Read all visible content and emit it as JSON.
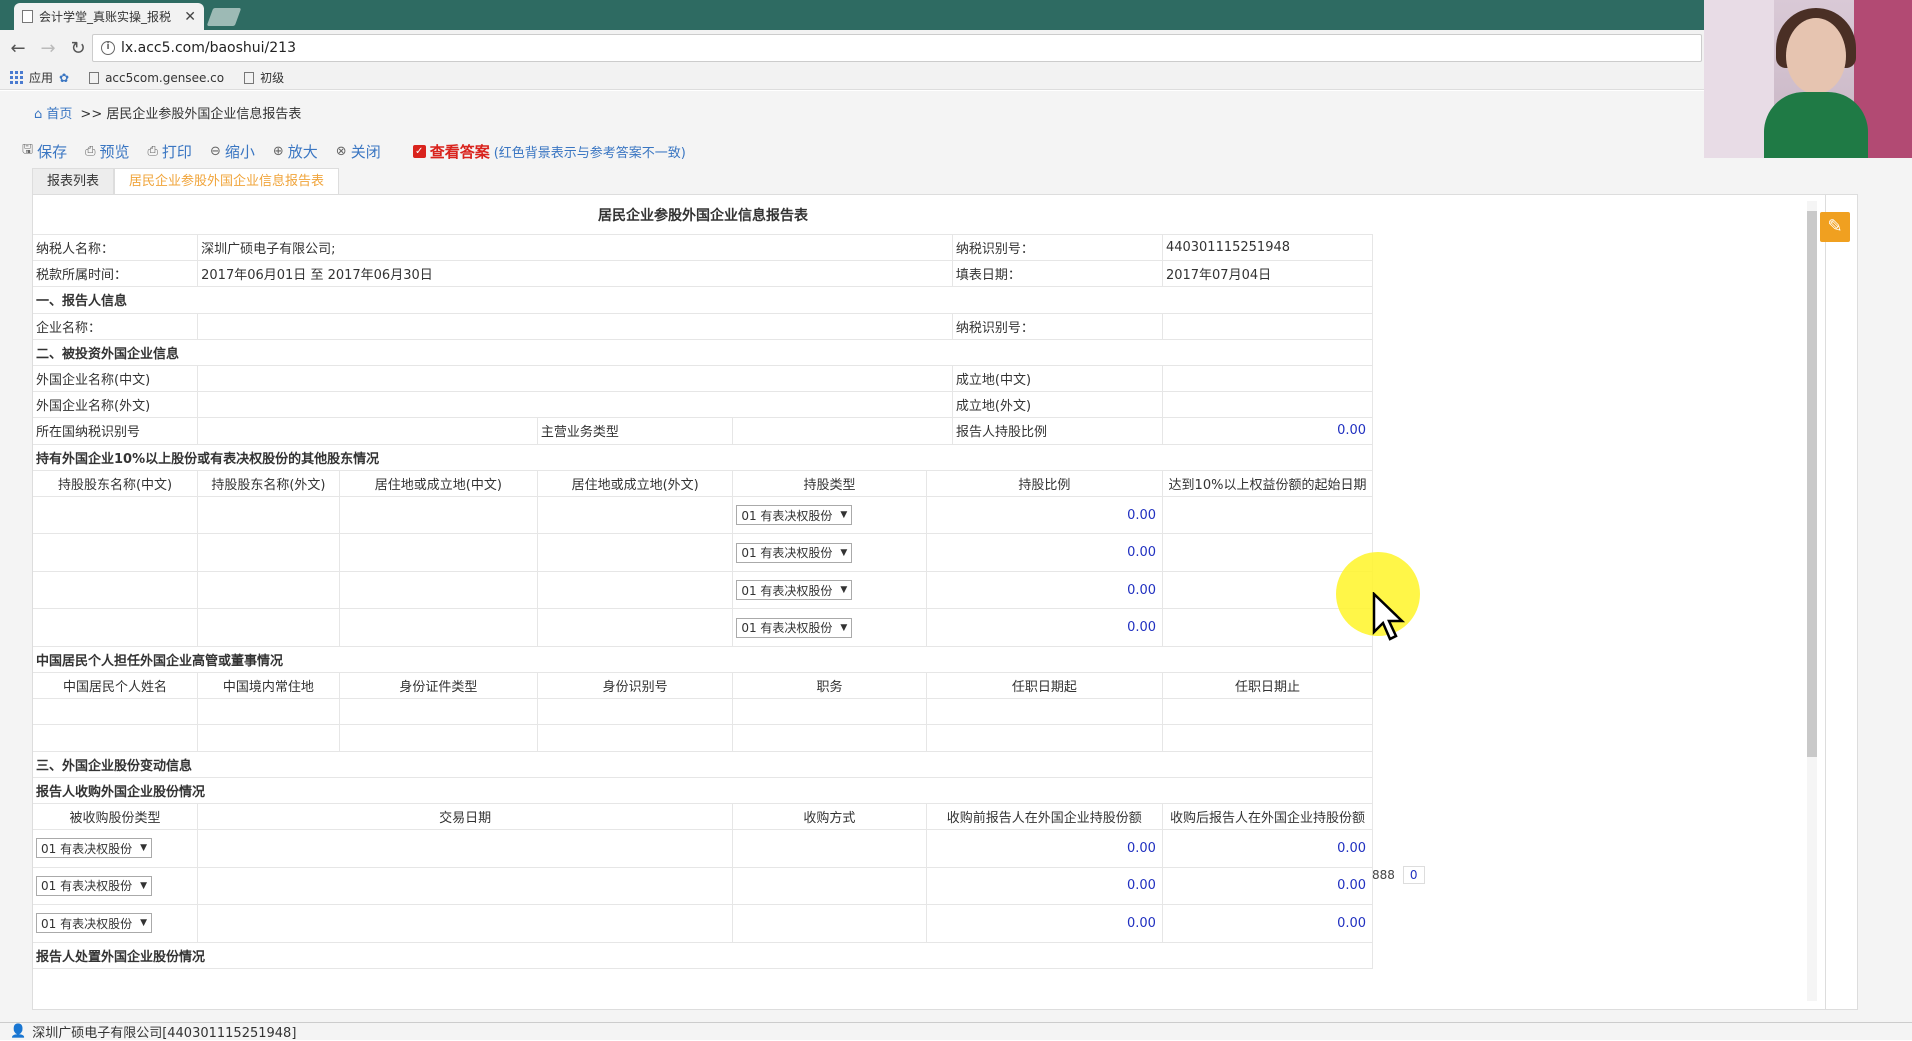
{
  "browser": {
    "tab_title": "会计学堂_真账实操_报税",
    "url": "lx.acc5.com/baoshui/213",
    "bookmarks": [
      "应用",
      "acc5com.gensee.co",
      "初级"
    ]
  },
  "breadcrumb": {
    "home": "首页",
    "current": ">> 居民企业参股外国企业信息报告表"
  },
  "actions": {
    "save": "保存",
    "preview": "预览",
    "print": "打印",
    "zoom_out": "缩小",
    "zoom_in": "放大",
    "close": "关闭",
    "view_answer": "查看答案",
    "hint": "(红色背景表示与参考答案不一致)"
  },
  "tabs": {
    "list": "报表列表",
    "current": "居民企业参股外国企业信息报告表"
  },
  "form": {
    "title": "居民企业参股外国企业信息报告表",
    "taxpayer_name_label": "纳税人名称：",
    "taxpayer_name": "深圳广硕电子有限公司;",
    "taxpayer_id_label": "纳税识别号：",
    "taxpayer_id": "440301115251948",
    "period_label": "税款所属时间：",
    "period": "2017年06月01日 至 2017年06月30日",
    "fill_date_label": "填表日期：",
    "fill_date": "2017年07月04日",
    "sec1": "一、报告人信息",
    "enterprise_name_label": "企业名称：",
    "sec1_taxid_label": "纳税识别号：",
    "sec2": "二、被投资外国企业信息",
    "foreign_name_cn": "外国企业名称(中文)",
    "foreign_name_en": "外国企业名称(外文)",
    "foreign_taxid": "所在国纳税识别号",
    "main_business": "主营业务类型",
    "est_place_cn": "成立地(中文)",
    "est_place_en": "成立地(外文)",
    "holding_ratio_label": "报告人持股比例",
    "holding_ratio": "0.00",
    "shareholders_title": "持有外国企业10%以上股份或有表决权股份的其他股东情况",
    "shareholders_headers": [
      "持股股东名称(中文)",
      "持股股东名称(外文)",
      "居住地或成立地(中文)",
      "居住地或成立地(外文)",
      "持股类型",
      "持股比例",
      "达到10%以上权益份额的起始日期"
    ],
    "shareholder_rows": [
      {
        "type": "01 有表决权股份",
        "ratio": "0.00"
      },
      {
        "type": "01 有表决权股份",
        "ratio": "0.00"
      },
      {
        "type": "01 有表决权股份",
        "ratio": "0.00"
      },
      {
        "type": "01 有表决权股份",
        "ratio": "0.00"
      }
    ],
    "officers_title": "中国居民个人担任外国企业高管或董事情况",
    "officers_headers": [
      "中国居民个人姓名",
      "中国境内常住地",
      "身份证件类型",
      "身份识别号",
      "职务",
      "任职日期起",
      "任职日期止"
    ],
    "sec3": "三、外国企业股份变动信息",
    "acq_title": "报告人收购外国企业股份情况",
    "acq_headers": [
      "被收购股份类型",
      "交易日期",
      "收购方式",
      "收购前报告人在外国企业持股份额",
      "收购后报告人在外国企业持股份额"
    ],
    "acq_rows": [
      {
        "type": "01 有表决权股份",
        "before": "0.00",
        "after": "0.00"
      },
      {
        "type": "01 有表决权股份",
        "before": "0.00",
        "after": "0.00"
      },
      {
        "type": "01 有表决权股份",
        "before": "0.00",
        "after": "0.00"
      }
    ],
    "disposal_title": "报告人处置外国企业股份情况",
    "extra_a": "888",
    "extra_b": "0"
  },
  "status": {
    "company": "深圳广硕电子有限公司[440301115251948]"
  }
}
